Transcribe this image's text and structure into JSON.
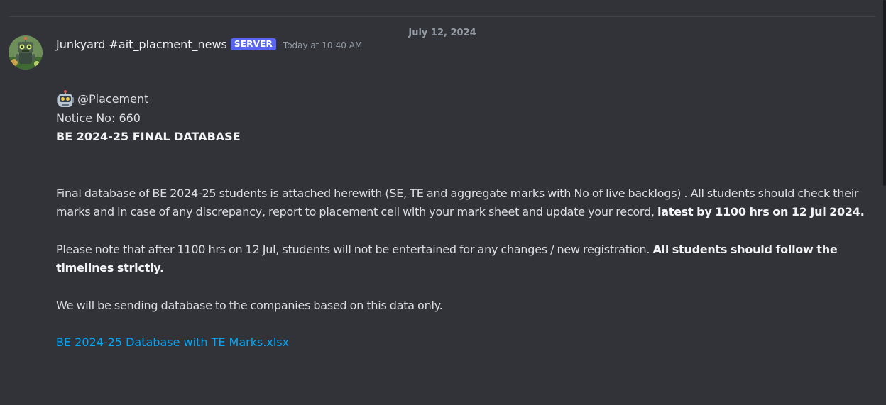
{
  "divider": {
    "date": "July 12, 2024"
  },
  "message": {
    "author": "Junkyard #ait_placment_news",
    "tag": "SERVER",
    "timestamp": "Today at 10:40 AM",
    "mention": "@Placement",
    "notice_no": "Notice No: 660",
    "headline": "BE 2024-25 FINAL DATABASE",
    "para1_text": "Final database of BE 2024-25 students is attached herewith (SE, TE and aggregate marks with No of live backlogs) . All students should check their marks and in case of any discrepancy, report to placement cell with your mark sheet and update your record, ",
    "para1_bold": "latest by 1100 hrs on 12 Jul 2024.",
    "para2_text": "Please note that after 1100 hrs on 12 Jul, students will not be entertained for any changes / new registration. ",
    "para2_bold": "All students should follow the timelines strictly.",
    "para3_text": "We will be sending database to the companies based on this data only.",
    "attachment_link": "BE 2024-25 Database with TE Marks.xlsx"
  },
  "icons": {
    "avatar": "robot-avatar",
    "mention_emoji": "robot-face-icon"
  },
  "colors": {
    "background": "#313338",
    "tag": "#5865f2",
    "link": "#00a8fc"
  }
}
